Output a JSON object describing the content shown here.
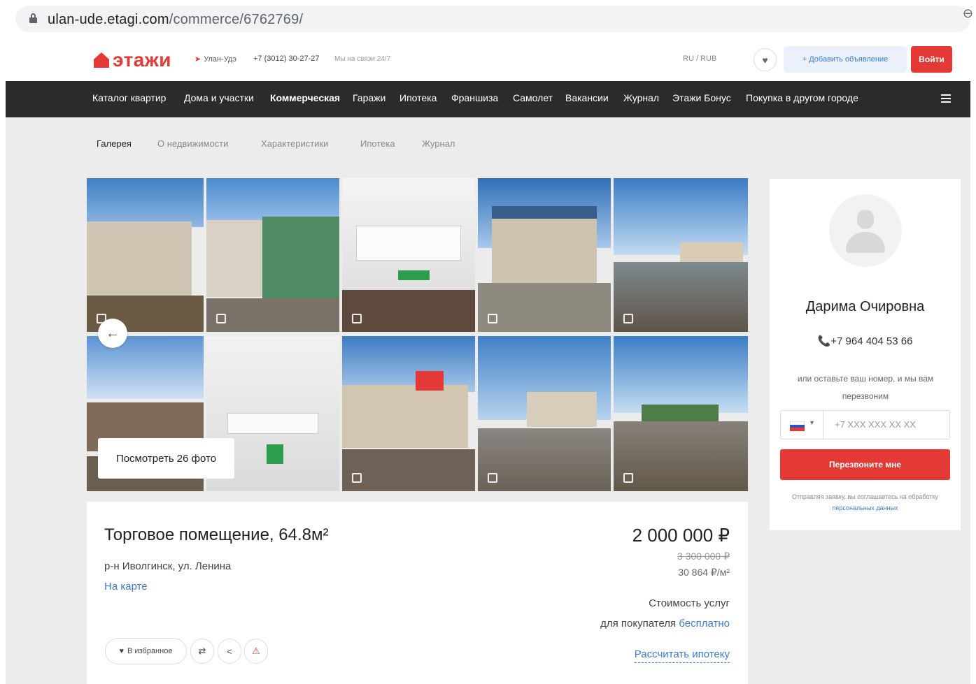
{
  "browser": {
    "url_host": "ulan-ude.etagi.com",
    "url_path": "/commerce/6762769/"
  },
  "header": {
    "logo_text": "этажи",
    "city": "Улан-Удэ",
    "phone": "+7 (3012) 30-27-27",
    "hours": "Мы на связи 24/7",
    "currency": "RU / RUB",
    "add_button": "+ Добавить объявление",
    "login_button": "Войти"
  },
  "nav": {
    "items": [
      {
        "label": "Каталог квартир"
      },
      {
        "label": "Дома и участки"
      },
      {
        "label": "Коммерческая"
      },
      {
        "label": "Гаражи"
      },
      {
        "label": "Ипотека"
      },
      {
        "label": "Франшиза"
      },
      {
        "label": "Самолет"
      },
      {
        "label": "Вакансии"
      },
      {
        "label": "Журнал"
      },
      {
        "label": "Этажи Бонус"
      },
      {
        "label": "Покупка в другом городе"
      }
    ]
  },
  "section_tabs": [
    {
      "label": "Галерея"
    },
    {
      "label": "О недвижимости"
    },
    {
      "label": "Характеристики"
    },
    {
      "label": "Ипотека"
    },
    {
      "label": "Журнал"
    }
  ],
  "gallery": {
    "see_all_label": "Посмотреть 26 фото"
  },
  "listing": {
    "title": "Торговое помещение, 64.8м²",
    "address": "р-н Иволгинск, ул. Ленина",
    "map_link": "На карте",
    "price": "2 000 000 ₽",
    "old_price": "3 300 000 ₽",
    "price_per_m2": "30 864 ₽/м²",
    "service_line1": "Стоимость услуг",
    "service_line2_prefix": "для покупателя ",
    "service_line2_link": "бесплатно",
    "mortgage_link": "Рассчитать ипотеку",
    "favorite_button": "В избранное"
  },
  "agent": {
    "name": "Дарима Очировна",
    "phone": "+7 964 404 53 66",
    "hint": "или оставьте ваш номер, и мы вам перезвоним",
    "phone_placeholder": "+7 XXX XXX XX XX",
    "callback_button": "Перезвоните мне",
    "consent_text": "Отправляя заявку, вы соглашаетесь на обработку ",
    "consent_link": "персональных данных"
  },
  "colors": {
    "brand": "#e53935",
    "link": "#3b7bd4",
    "nav_bg": "#2b2b2b"
  }
}
